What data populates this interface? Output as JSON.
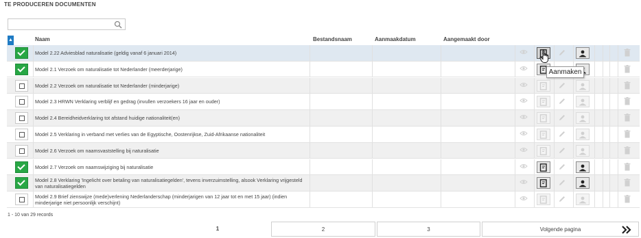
{
  "section_title": "TE PRODUCEREN DOCUMENTEN",
  "search": {
    "value": "",
    "placeholder": ""
  },
  "columns": {
    "naam": "Naam",
    "bestandsnaam": "Bestandsnaam",
    "aanmaakdatum": "Aanmaakdatum",
    "aangemaakt_door": "Aangemaakt door"
  },
  "rows": [
    {
      "checked": true,
      "naam": "Model 2.22 Adviesblad naturalisatie (geldig vanaf 6 januari 2014)",
      "actions_enabled": true
    },
    {
      "checked": true,
      "naam": "Model 2.1 Verzoek om naturalisatie tot Nederlander (meerderjarige)",
      "actions_enabled": true
    },
    {
      "checked": false,
      "naam": "Model 2.2 Verzoek om naturalisatie tot Nederlander (minderjarige)",
      "actions_enabled": false
    },
    {
      "checked": false,
      "naam": "Model 2.3 HRWN Verklaring verblijf en gedrag (invullen verzoekers 16 jaar en ouder)",
      "actions_enabled": false
    },
    {
      "checked": false,
      "naam": "Model 2.4 Bereidheidverklaring tot afstand huidige nationaliteit(en)",
      "actions_enabled": false
    },
    {
      "checked": false,
      "naam": "Model 2.5 Verklaring in verband met verlies van de Egyptische, Oostenrijkse, Zuid-Afrikaanse nationaliteit",
      "actions_enabled": false
    },
    {
      "checked": false,
      "naam": "Model 2.6 Verzoek om naamsvaststelling bij naturalisatie",
      "actions_enabled": false
    },
    {
      "checked": true,
      "naam": "Model 2.7 Verzoek om naamswijziging bij naturalisatie",
      "actions_enabled": true
    },
    {
      "checked": true,
      "naam": "Model 2.8 Verklaring 'Ingelicht over betaling van naturalisatiegelden', tevens inverzuimstelling, alsook Verklaring vrijgesteld van naturalisatiegelden",
      "actions_enabled": true
    },
    {
      "checked": false,
      "naam": "Model 2.9 Brief zienswijze (mede)verlening Nederlanderschap (minderjarigen van 12 jaar tot en met 15 jaar) (indien minderjarige niet persoonlijk verschijnt)",
      "actions_enabled": false
    }
  ],
  "tooltip": "Aanmaken",
  "records_text": "1 - 10 van 29 records",
  "pager": {
    "page1": "1",
    "page2": "2",
    "page3": "3",
    "next": "Volgende pagina"
  },
  "colors": {
    "accent": "#1f7bc4",
    "checked": "#28a745",
    "selected_row": "#dfe8f1"
  },
  "icons": {
    "search": "search-icon",
    "sort": "sort-up-icon",
    "view": "eye-icon",
    "create": "document-icon",
    "edit": "pencil-icon",
    "assign": "user-icon",
    "delete": "trash-icon",
    "next": "double-chevron-right-icon"
  }
}
